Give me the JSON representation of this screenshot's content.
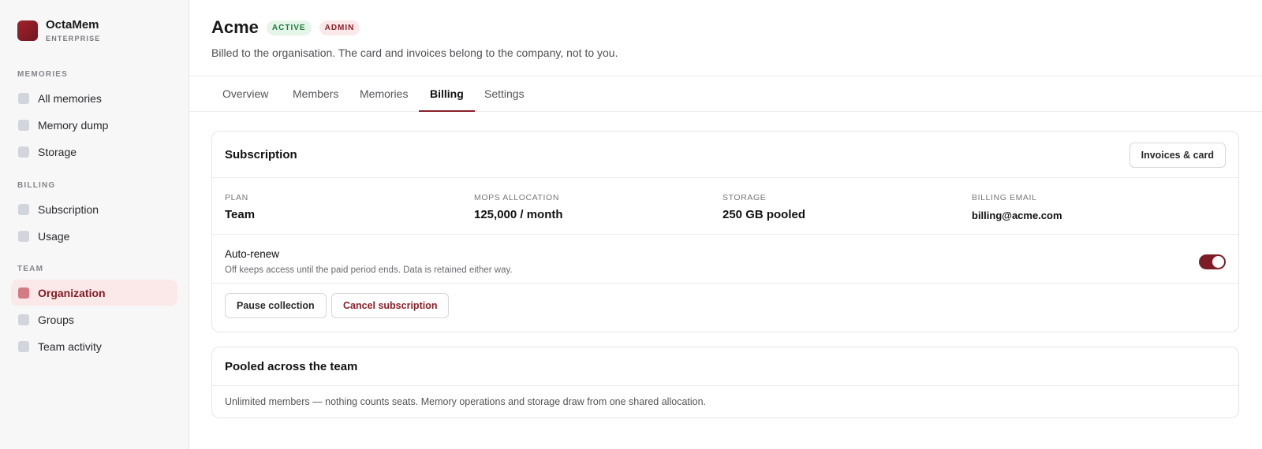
{
  "brand": {
    "name": "OctaMem",
    "tier": "ENTERPRISE"
  },
  "sidebar": {
    "sections": [
      {
        "title": "MEMORIES",
        "items": [
          {
            "label": "All memories"
          },
          {
            "label": "Memory dump"
          },
          {
            "label": "Storage"
          }
        ]
      },
      {
        "title": "BILLING",
        "items": [
          {
            "label": "Subscription"
          },
          {
            "label": "Usage"
          }
        ]
      },
      {
        "title": "TEAM",
        "items": [
          {
            "label": "Organization",
            "active": true
          },
          {
            "label": "Groups"
          },
          {
            "label": "Team activity"
          }
        ]
      }
    ]
  },
  "header": {
    "title": "Acme",
    "badges": {
      "status": "ACTIVE",
      "role": "ADMIN"
    },
    "subtitle": "Billed to the organisation. The card and invoices belong to the company, not to you."
  },
  "tabs": [
    {
      "label": "Overview"
    },
    {
      "label": "Members"
    },
    {
      "label": "Memories"
    },
    {
      "label": "Billing",
      "active": true
    },
    {
      "label": "Settings"
    }
  ],
  "subscription": {
    "title": "Subscription",
    "invoices_button": "Invoices & card",
    "stats": [
      {
        "label": "PLAN",
        "value": "Team"
      },
      {
        "label": "MOPS ALLOCATION",
        "value": "125,000 / month"
      },
      {
        "label": "STORAGE",
        "value": "250 GB pooled"
      },
      {
        "label": "BILLING EMAIL",
        "value": "billing@acme.com"
      }
    ],
    "auto_renew": {
      "title": "Auto-renew",
      "description": "Off keeps access until the paid period ends. Data is retained either way.",
      "enabled": true
    },
    "pause_button": "Pause collection",
    "cancel_button": "Cancel subscription"
  },
  "pooled": {
    "title": "Pooled across the team",
    "description": "Unlimited members — nothing counts seats. Memory operations and storage draw from one shared allocation."
  },
  "colors": {
    "accent": "#7d1c24",
    "active_nav_bg": "#fbe8e9",
    "badge_active_bg": "#e5f5ea",
    "badge_active_text": "#1d7a3a"
  }
}
